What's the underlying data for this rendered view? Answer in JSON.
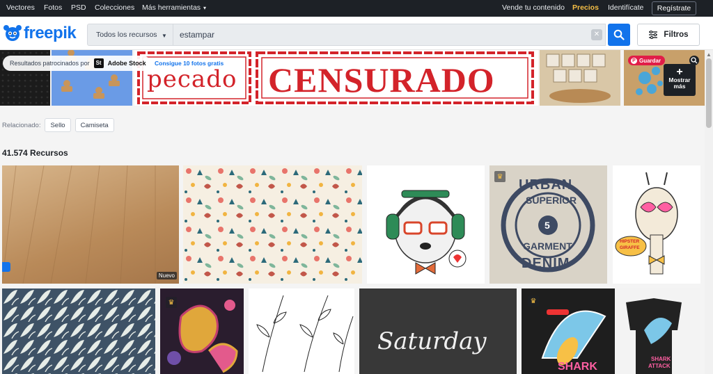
{
  "topbar": {
    "left_links": [
      "Vectores",
      "Fotos",
      "PSD",
      "Colecciones",
      "Más herramientas"
    ],
    "sell": "Vende tu contenido",
    "pricing": "Precios",
    "login": "Identifícate",
    "register": "Regístrate"
  },
  "logo": {
    "text": "freepik"
  },
  "search": {
    "category": "Todos los recursos",
    "query": "estampar",
    "filters_label": "Filtros"
  },
  "sponsored": {
    "label": "Resultados patrocinados por",
    "brand": "Adobe Stock",
    "brand_short": "St",
    "promo_link": "Consigue 10 fotos gratis",
    "save_label": "Guardar",
    "more_label": "Mostrar más",
    "stamp_left_text": "pecado",
    "stamp_main_text": "CENSURADO"
  },
  "related": {
    "label": "Relacionado:",
    "tags": [
      "Sello",
      "Camiseta"
    ]
  },
  "results": {
    "count_label": "41.574 Recursos",
    "new_badge": "Nuevo",
    "tile_texts": {
      "urban_1": "URBAN",
      "urban_2": "SUPERIOR",
      "urban_3": "GARMENT",
      "urban_4": "DENIM",
      "urban_5": "5",
      "giraffe_1": "HIPSTER",
      "giraffe_2": "GIRAFFE",
      "saturday": "Saturday",
      "shark_1": "SHARK",
      "shark_2": "SHARK",
      "shark_3": "ATTACK"
    }
  },
  "colors": {
    "brand": "#1273eb",
    "topbar_bg": "#1d2126",
    "accent_yellow": "#f7c046",
    "stamp_red": "#d3232a",
    "save_red": "#e11d48"
  }
}
